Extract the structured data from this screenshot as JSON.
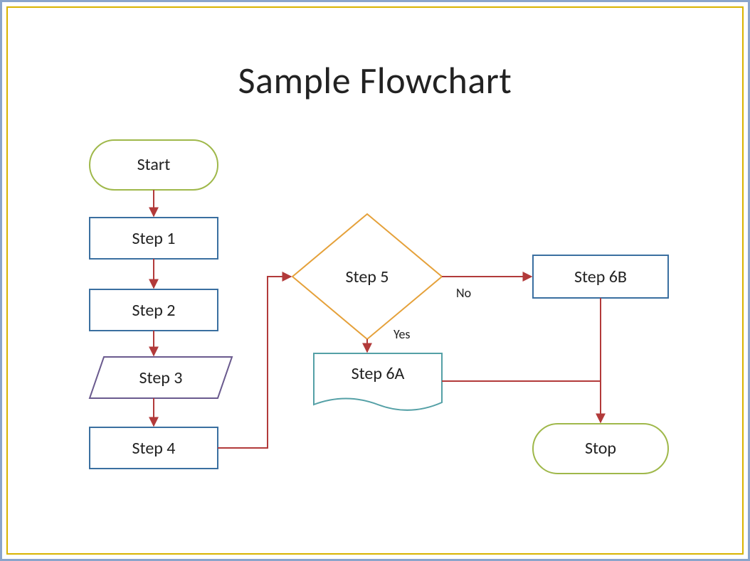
{
  "title": "Sample Flowchart",
  "nodes": {
    "start": "Start",
    "step1": "Step 1",
    "step2": "Step 2",
    "step3": "Step 3",
    "step4": "Step 4",
    "step5": "Step 5",
    "step6a": "Step 6A",
    "step6b": "Step 6B",
    "stop": "Stop"
  },
  "labels": {
    "no": "No",
    "yes": "Yes"
  },
  "colors": {
    "terminatorBorder": "#9fb84a",
    "processBorder": "#3a6fa0",
    "connector": "#b23a3a",
    "decisionBorder": "#e5a13a",
    "dataBorder": "#6a5a8e",
    "docBorder": "#54a0a6"
  }
}
